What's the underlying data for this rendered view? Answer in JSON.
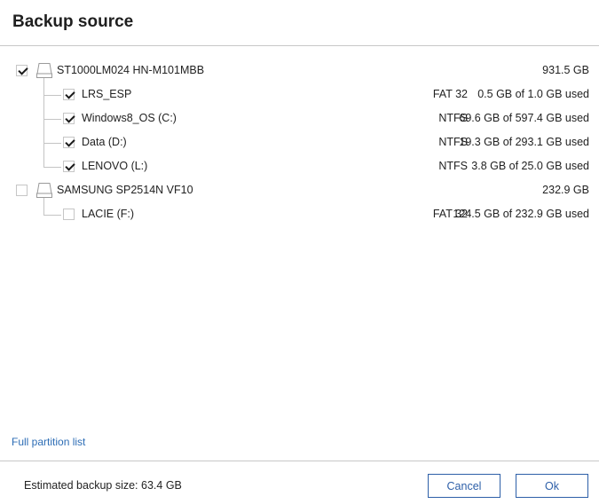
{
  "dialog": {
    "title": "Backup source"
  },
  "disks": [
    {
      "name": "ST1000LM024 HN-M101MBB",
      "size": "931.5 GB",
      "checked": true,
      "partitions": [
        {
          "name": "LRS_ESP",
          "fs": "FAT 32",
          "usage": "0.5 GB of 1.0 GB used",
          "checked": true
        },
        {
          "name": "Windows8_OS (C:)",
          "fs": "NTFS",
          "usage": "69.6 GB of 597.4 GB used",
          "checked": true
        },
        {
          "name": "Data (D:)",
          "fs": "NTFS",
          "usage": "19.3 GB of 293.1 GB used",
          "checked": true
        },
        {
          "name": "LENOVO (L:)",
          "fs": "NTFS",
          "usage": "3.8 GB of 25.0 GB used",
          "checked": true
        }
      ]
    },
    {
      "name": "SAMSUNG SP2514N VF10",
      "size": "232.9 GB",
      "checked": false,
      "partitions": [
        {
          "name": "LACIE (F:)",
          "fs": "FAT 32",
          "usage": "124.5 GB of 232.9 GB used",
          "checked": false
        }
      ]
    }
  ],
  "links": {
    "full_partition_list": "Full partition list"
  },
  "footer": {
    "estimate_label": "Estimated backup size:",
    "estimate_value": "63.4 GB",
    "cancel_label": "Cancel",
    "ok_label": "Ok"
  },
  "colors": {
    "accent": "#2d5fa8",
    "link": "#2d6db5",
    "divider": "#c8c8c8"
  },
  "icons": {
    "disk": "hard-drive-icon"
  }
}
